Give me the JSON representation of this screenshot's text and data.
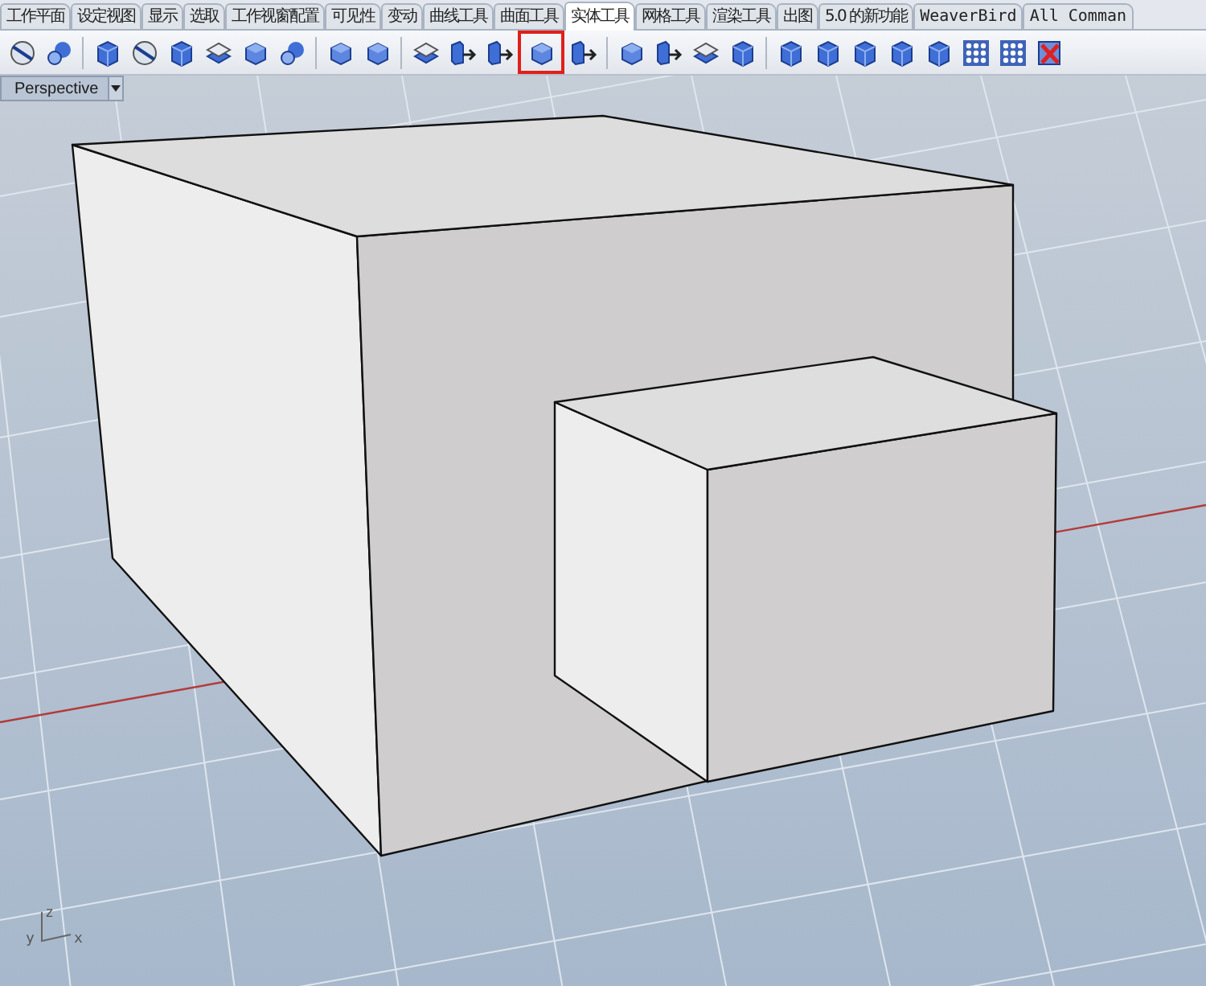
{
  "tabs": [
    {
      "label": "工作平面",
      "selected": false
    },
    {
      "label": "设定视图",
      "selected": false
    },
    {
      "label": "显示",
      "selected": false
    },
    {
      "label": "选取",
      "selected": false
    },
    {
      "label": "工作视窗配置",
      "selected": false
    },
    {
      "label": "可见性",
      "selected": false
    },
    {
      "label": "变动",
      "selected": false
    },
    {
      "label": "曲线工具",
      "selected": false
    },
    {
      "label": "曲面工具",
      "selected": false
    },
    {
      "label": "实体工具",
      "selected": true
    },
    {
      "label": "网格工具",
      "selected": false
    },
    {
      "label": "渲染工具",
      "selected": false
    },
    {
      "label": "出图",
      "selected": false
    },
    {
      "label": "5.0 的新功能",
      "selected": false
    },
    {
      "label": "WeaverBird",
      "selected": false
    },
    {
      "label": "All Comman",
      "selected": false
    }
  ],
  "toolbar": [
    {
      "kind": "ring",
      "highlighted": false
    },
    {
      "kind": "sphere",
      "highlighted": false
    },
    {
      "kind": "separator"
    },
    {
      "kind": "box",
      "highlighted": false
    },
    {
      "kind": "ring",
      "highlighted": false
    },
    {
      "kind": "box",
      "highlighted": false
    },
    {
      "kind": "layers",
      "highlighted": false
    },
    {
      "kind": "cube",
      "highlighted": false
    },
    {
      "kind": "sphere",
      "highlighted": false
    },
    {
      "kind": "separator"
    },
    {
      "kind": "cube",
      "highlighted": false
    },
    {
      "kind": "cube",
      "highlighted": false
    },
    {
      "kind": "separator"
    },
    {
      "kind": "layers",
      "highlighted": false
    },
    {
      "kind": "arrow",
      "highlighted": false
    },
    {
      "kind": "arrow",
      "highlighted": false
    },
    {
      "kind": "cube",
      "highlighted": true
    },
    {
      "kind": "arrow",
      "highlighted": false
    },
    {
      "kind": "separator"
    },
    {
      "kind": "cube",
      "highlighted": false
    },
    {
      "kind": "arrow",
      "highlighted": false
    },
    {
      "kind": "layers",
      "highlighted": false
    },
    {
      "kind": "box",
      "highlighted": false
    },
    {
      "kind": "separator"
    },
    {
      "kind": "box",
      "highlighted": false
    },
    {
      "kind": "box",
      "highlighted": false
    },
    {
      "kind": "box",
      "highlighted": false
    },
    {
      "kind": "box",
      "highlighted": false
    },
    {
      "kind": "box",
      "highlighted": false
    },
    {
      "kind": "grid",
      "highlighted": false
    },
    {
      "kind": "grid",
      "highlighted": false
    },
    {
      "kind": "delete",
      "highlighted": false
    }
  ],
  "viewport": {
    "title": "Perspective",
    "axes": [
      {
        "label": "z"
      },
      {
        "label": "y"
      },
      {
        "label": "x"
      }
    ]
  }
}
